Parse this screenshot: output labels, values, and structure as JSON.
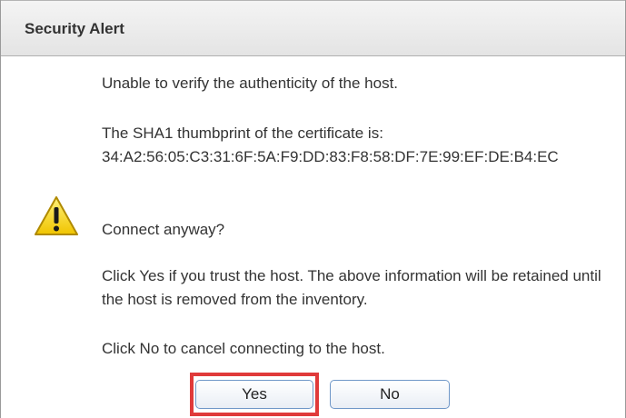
{
  "dialog": {
    "title": "Security Alert",
    "icon": "warning-icon",
    "message_line1": "Unable to verify the authenticity of the host.",
    "thumbprint_intro": "The SHA1 thumbprint of the certificate is:",
    "thumbprint": "34:A2:56:05:C3:31:6F:5A:F9:DD:83:F8:58:DF:7E:99:EF:DE:B4:EC",
    "question": "Connect anyway?",
    "yes_info": "Click Yes if you trust the host. The above information will be retained until the host is removed from the inventory.",
    "no_info": "Click No to cancel connecting to the host."
  },
  "buttons": {
    "yes_label": "Yes",
    "no_label": "No"
  },
  "colors": {
    "highlight": "#e03a3a",
    "button_border": "#6f97c8",
    "titlebar": "#ececec",
    "warning_yellow": "#f4d21f"
  }
}
